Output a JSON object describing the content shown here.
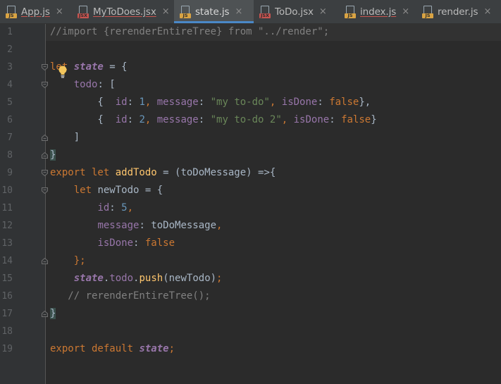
{
  "tabs": [
    {
      "label": "App.js",
      "type": "JS",
      "active": false,
      "underline": true
    },
    {
      "label": "MyToDoes.jsx",
      "type": "JSX",
      "active": false,
      "underline": true
    },
    {
      "label": "state.js",
      "type": "JS",
      "active": true,
      "underline": false
    },
    {
      "label": "ToDo.jsx",
      "type": "JSX",
      "active": false,
      "underline": false
    },
    {
      "label": "index.js",
      "type": "JS",
      "active": false,
      "underline": true
    },
    {
      "label": "render.js",
      "type": "JS",
      "active": false,
      "underline": false
    }
  ],
  "tab_close_glyph": "×",
  "editor": {
    "current_line": 1,
    "line_numbers": [
      "1",
      "2",
      "3",
      "4",
      "5",
      "6",
      "7",
      "8",
      "9",
      "10",
      "11",
      "12",
      "13",
      "14",
      "15",
      "16",
      "17",
      "18",
      "19"
    ],
    "lines": [
      [
        {
          "t": "//import {rerenderEntireTree} from \"../render\";",
          "c": "cmt"
        }
      ],
      [],
      [
        {
          "t": "let ",
          "c": "kw"
        },
        {
          "t": "state",
          "c": "obj"
        },
        {
          "t": " = {",
          "c": "pl"
        }
      ],
      [
        {
          "t": "    ",
          "c": "pl"
        },
        {
          "t": "todo",
          "c": "prop"
        },
        {
          "t": ": [",
          "c": "pl"
        }
      ],
      [
        {
          "t": "        {  ",
          "c": "pl"
        },
        {
          "t": "id",
          "c": "prop"
        },
        {
          "t": ": ",
          "c": "pl"
        },
        {
          "t": "1",
          "c": "num"
        },
        {
          "t": ", ",
          "c": "kw"
        },
        {
          "t": "message",
          "c": "prop"
        },
        {
          "t": ": ",
          "c": "pl"
        },
        {
          "t": "\"my to-do\"",
          "c": "str"
        },
        {
          "t": ", ",
          "c": "kw"
        },
        {
          "t": "isDone",
          "c": "prop"
        },
        {
          "t": ": ",
          "c": "pl"
        },
        {
          "t": "false",
          "c": "kw"
        },
        {
          "t": "},",
          "c": "pl"
        }
      ],
      [
        {
          "t": "        {  ",
          "c": "pl"
        },
        {
          "t": "id",
          "c": "prop"
        },
        {
          "t": ": ",
          "c": "pl"
        },
        {
          "t": "2",
          "c": "num"
        },
        {
          "t": ", ",
          "c": "kw"
        },
        {
          "t": "message",
          "c": "prop"
        },
        {
          "t": ": ",
          "c": "pl"
        },
        {
          "t": "\"my to-do 2\"",
          "c": "str"
        },
        {
          "t": ", ",
          "c": "kw"
        },
        {
          "t": "isDone",
          "c": "prop"
        },
        {
          "t": ": ",
          "c": "pl"
        },
        {
          "t": "false",
          "c": "kw"
        },
        {
          "t": "}",
          "c": "pl"
        }
      ],
      [
        {
          "t": "    ]",
          "c": "pl"
        }
      ],
      [
        {
          "t": "}",
          "c": "brace"
        }
      ],
      [
        {
          "t": "export let ",
          "c": "kw"
        },
        {
          "t": "addTodo",
          "c": "fn"
        },
        {
          "t": " = (toDoMessage) =>{",
          "c": "pl"
        }
      ],
      [
        {
          "t": "    ",
          "c": "pl"
        },
        {
          "t": "let ",
          "c": "kw"
        },
        {
          "t": "newTodo = {",
          "c": "pl"
        }
      ],
      [
        {
          "t": "        ",
          "c": "pl"
        },
        {
          "t": "id",
          "c": "prop"
        },
        {
          "t": ": ",
          "c": "pl"
        },
        {
          "t": "5",
          "c": "num"
        },
        {
          "t": ",",
          "c": "kw"
        }
      ],
      [
        {
          "t": "        ",
          "c": "pl"
        },
        {
          "t": "message",
          "c": "prop"
        },
        {
          "t": ": toDoMessage",
          "c": "pl"
        },
        {
          "t": ",",
          "c": "kw"
        }
      ],
      [
        {
          "t": "        ",
          "c": "pl"
        },
        {
          "t": "isDone",
          "c": "prop"
        },
        {
          "t": ": ",
          "c": "pl"
        },
        {
          "t": "false",
          "c": "kw"
        }
      ],
      [
        {
          "t": "    };",
          "c": "kw"
        }
      ],
      [
        {
          "t": "    ",
          "c": "pl"
        },
        {
          "t": "state",
          "c": "obj"
        },
        {
          "t": ".",
          "c": "pl"
        },
        {
          "t": "todo",
          "c": "prop"
        },
        {
          "t": ".",
          "c": "pl"
        },
        {
          "t": "push",
          "c": "fn"
        },
        {
          "t": "(newTodo)",
          "c": "pl"
        },
        {
          "t": ";",
          "c": "kw"
        }
      ],
      [
        {
          "t": "   // rerenderEntireTree();",
          "c": "cmt"
        }
      ],
      [
        {
          "t": "}",
          "c": "brace"
        }
      ],
      [],
      [
        {
          "t": "export default ",
          "c": "kw"
        },
        {
          "t": "state",
          "c": "obj"
        },
        {
          "t": ";",
          "c": "kw"
        }
      ]
    ]
  },
  "fold_markers": [
    {
      "line": 3,
      "kind": "open"
    },
    {
      "line": 4,
      "kind": "open"
    },
    {
      "line": 7,
      "kind": "close"
    },
    {
      "line": 8,
      "kind": "close"
    },
    {
      "line": 9,
      "kind": "open"
    },
    {
      "line": 10,
      "kind": "open"
    },
    {
      "line": 14,
      "kind": "close"
    },
    {
      "line": 17,
      "kind": "close"
    }
  ],
  "icons": {
    "intention": "lightbulb-icon"
  },
  "colors": {
    "background": "#2b2b2b",
    "gutter": "#313335",
    "keyword": "#cc7832",
    "property": "#9876aa",
    "number": "#6897bb",
    "string": "#6a8759",
    "function": "#ffc66d",
    "comment": "#808080",
    "text": "#a9b7c6",
    "tab_active_underline": "#4a88c7"
  }
}
